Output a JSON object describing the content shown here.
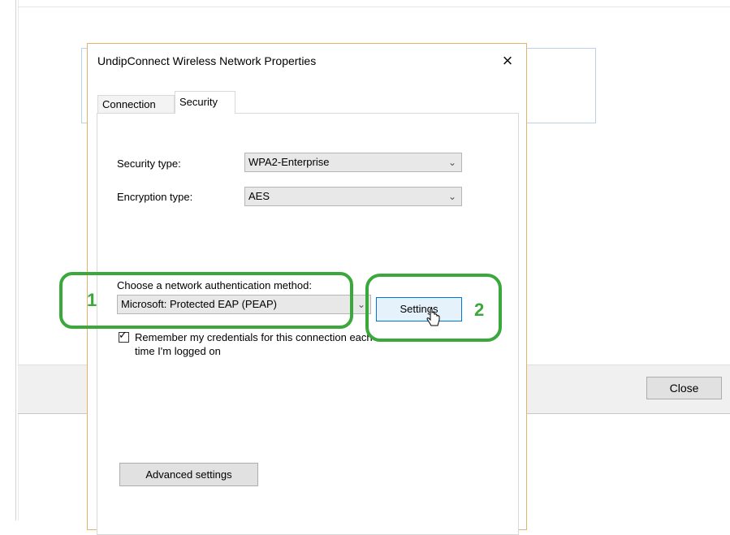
{
  "dialog": {
    "title": "UndipConnect Wireless Network Properties",
    "close_glyph": "×",
    "tabs": [
      {
        "label": "Connection",
        "active": false
      },
      {
        "label": "Security",
        "active": true
      }
    ],
    "security_type_label": "Security type:",
    "security_type_value": "WPA2-Enterprise",
    "encryption_type_label": "Encryption type:",
    "encryption_type_value": "AES",
    "auth_method_label": "Choose a network authentication method:",
    "auth_method_value": "Microsoft: Protected EAP (PEAP)",
    "settings_button": "Settings",
    "remember_checkbox_checked": true,
    "remember_label_line1": "Remember my credentials for this connection each",
    "remember_label_line2": "time I'm logged on",
    "advanced_button": "Advanced settings"
  },
  "background_window": {
    "close_button": "Close"
  },
  "annotations": [
    {
      "number": "1",
      "color": "#3aa83a"
    },
    {
      "number": "2",
      "color": "#3aa83a"
    }
  ]
}
